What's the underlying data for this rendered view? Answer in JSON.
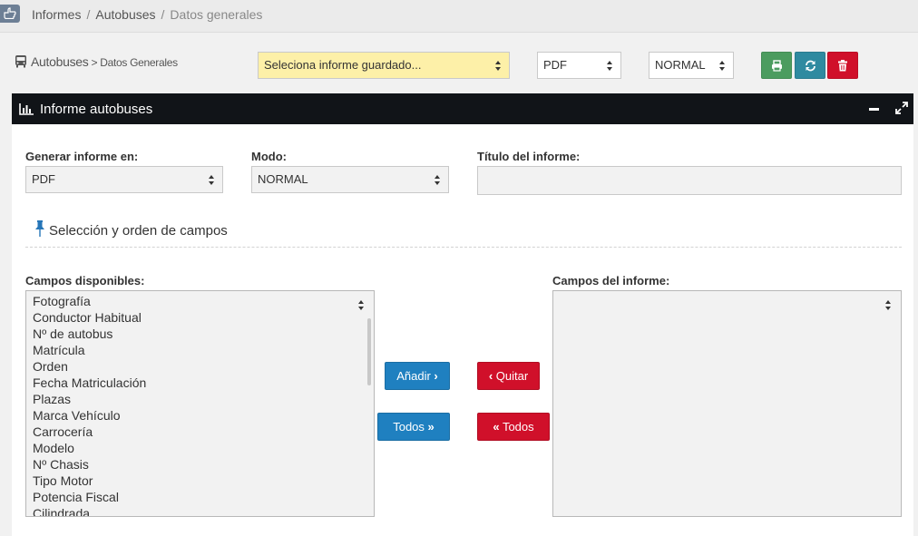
{
  "breadcrumb": {
    "items": [
      "Informes",
      "Autobuses",
      "Datos generales"
    ]
  },
  "header": {
    "title_main": "Autobuses",
    "title_sub": "Datos Generales",
    "saved_report_select": "Seleciona informe guardado...",
    "format_select": "PDF",
    "mode_select": "NORMAL"
  },
  "panel": {
    "title": "Informe autobuses",
    "form": {
      "format_label": "Generar informe en:",
      "format_value": "PDF",
      "mode_label": "Modo:",
      "mode_value": "NORMAL",
      "title_label": "Título del informe:",
      "title_value": ""
    },
    "section_title": "Selección y orden de campos",
    "available_label": "Campos disponibles:",
    "report_label": "Campos del informe:",
    "available_fields": [
      "Fotografía",
      "Conductor Habitual",
      "Nº de autobus",
      "Matrícula",
      "Orden",
      "Fecha Matriculación",
      "Plazas",
      "Marca Vehículo",
      "Carrocería",
      "Modelo",
      "Nº Chasis",
      "Tipo Motor",
      "Potencia Fiscal",
      "Cilindrada"
    ],
    "report_fields": [],
    "buttons": {
      "add": "Añadir",
      "remove": "Quitar",
      "add_all": "Todos",
      "remove_all": "Todos"
    }
  },
  "colors": {
    "green": "#4c9c5f",
    "teal": "#2f8aa0",
    "red": "#d0102a",
    "blue": "#1f80c0",
    "yellow": "#fdf0a8"
  }
}
